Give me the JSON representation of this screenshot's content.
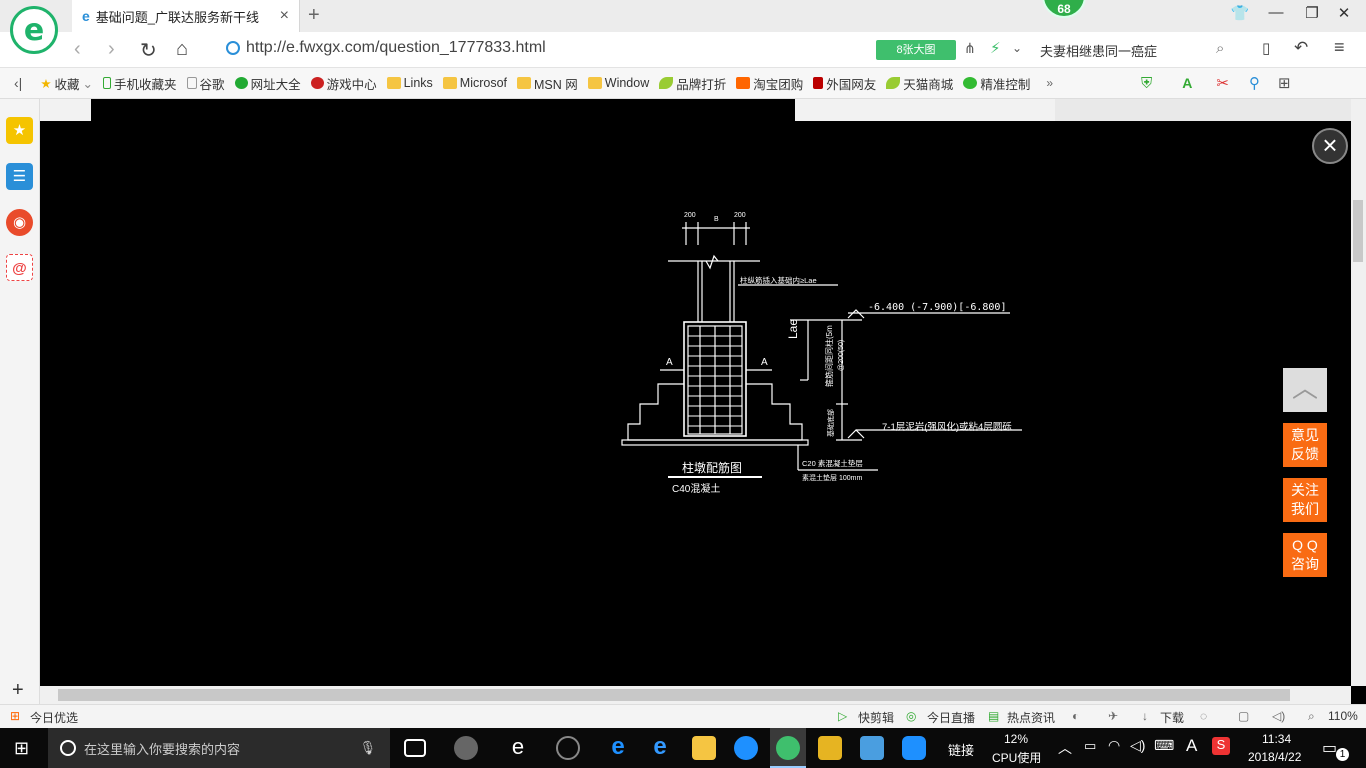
{
  "browser": {
    "tab_title": "基础问题_广联达服务新干线",
    "badge_count": "68",
    "url": "http://e.fwxgx.com/question_1777833.html",
    "big_pic_label": "8张大图",
    "search_text": "夫妻相继患同一癌症"
  },
  "bookmarks": [
    {
      "label": "收藏",
      "icon": "star-icon"
    },
    {
      "label": "手机收藏夹",
      "icon": "phone-icon"
    },
    {
      "label": "谷歌",
      "icon": "page-icon"
    },
    {
      "label": "网址大全",
      "icon": "globe-icon"
    },
    {
      "label": "游戏中心",
      "icon": "game-icon"
    },
    {
      "label": "Links",
      "icon": "folder-icon"
    },
    {
      "label": "Microsof",
      "icon": "folder-icon"
    },
    {
      "label": "MSN 网",
      "icon": "folder-icon"
    },
    {
      "label": "Window",
      "icon": "folder-icon"
    },
    {
      "label": "品牌打折",
      "icon": "leaf-icon"
    },
    {
      "label": "淘宝团购",
      "icon": "taobao-icon"
    },
    {
      "label": "外国网友",
      "icon": "flag-icon"
    },
    {
      "label": "天猫商城",
      "icon": "leaf-icon"
    },
    {
      "label": "精准控制",
      "icon": "wechat-icon"
    }
  ],
  "drawing": {
    "dim_left": "200",
    "dim_mid": "B",
    "dim_right": "200",
    "note_anchor": "柱纵筋插入基础内≥Lae",
    "elev_top": "-6.400 (-7.900)[-6.800]",
    "lae_label": "Lae",
    "vert_note_1": "箍筋间距同柱(5m",
    "vert_note_2": "@200(50)",
    "vert_note_3": "基础底部",
    "section_a_left": "A",
    "section_a_right": "A",
    "layer_note": "7-1层泥岩(强风化)或粘4层圆砾",
    "title": "柱墩配筋图",
    "concrete": "C40混凝土",
    "cushion_1": "C20  素混凝土垫层",
    "cushion_2": "素混土垫层 100mm"
  },
  "side_widgets": {
    "feedback": [
      "意见",
      "反馈"
    ],
    "follow": [
      "关注",
      "我们"
    ],
    "qq": [
      "Q Q",
      "咨询"
    ]
  },
  "status": {
    "today_pick": "今日优选",
    "quick_cut": "快剪辑",
    "live": "今日直播",
    "news": "热点资讯",
    "download": "下载",
    "zoom": "110%"
  },
  "taskbar": {
    "search_placeholder": "在这里输入你要搜索的内容",
    "links": "链接",
    "cpu_percent": "12%",
    "cpu_label": "CPU使用",
    "ime": "A",
    "time": "11:34",
    "date": "2018/4/22",
    "notif_count": "1"
  }
}
